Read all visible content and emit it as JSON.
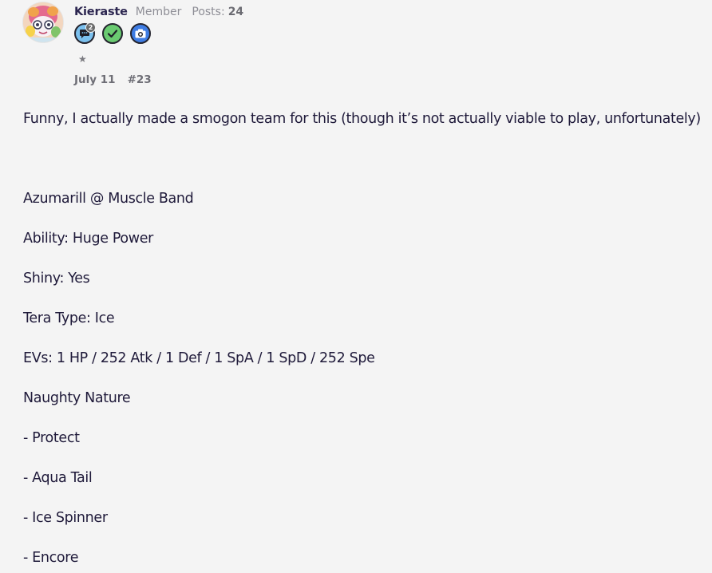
{
  "author": {
    "username": "Kieraste",
    "title": "Member",
    "posts_label": "Posts:",
    "posts_count": "24",
    "avatar_icon": "pokemon-avatar-icon"
  },
  "badges": [
    {
      "name": "chat-bubble-icon",
      "count": "2",
      "color": "#7bc0ee"
    },
    {
      "name": "checkmark-icon",
      "color": "#6acb71"
    },
    {
      "name": "camera-icon",
      "color": "#3f7de4"
    }
  ],
  "trophy_star": "★",
  "meta": {
    "date": "July 11",
    "post_number": "#23"
  },
  "body": {
    "intro": "Funny, I actually made a smogon team for this (though it’s not actually viable to play, unfortunately)",
    "lines": [
      "Azumarill @ Muscle Band",
      "Ability: Huge Power",
      "Shiny: Yes",
      "Tera Type: Ice",
      "EVs: 1 HP / 252 Atk / 1 Def / 1 SpA / 1 SpD / 252 Spe",
      "Naughty Nature",
      "- Protect",
      "- Aqua Tail",
      "- Ice Spinner",
      "- Encore"
    ]
  }
}
